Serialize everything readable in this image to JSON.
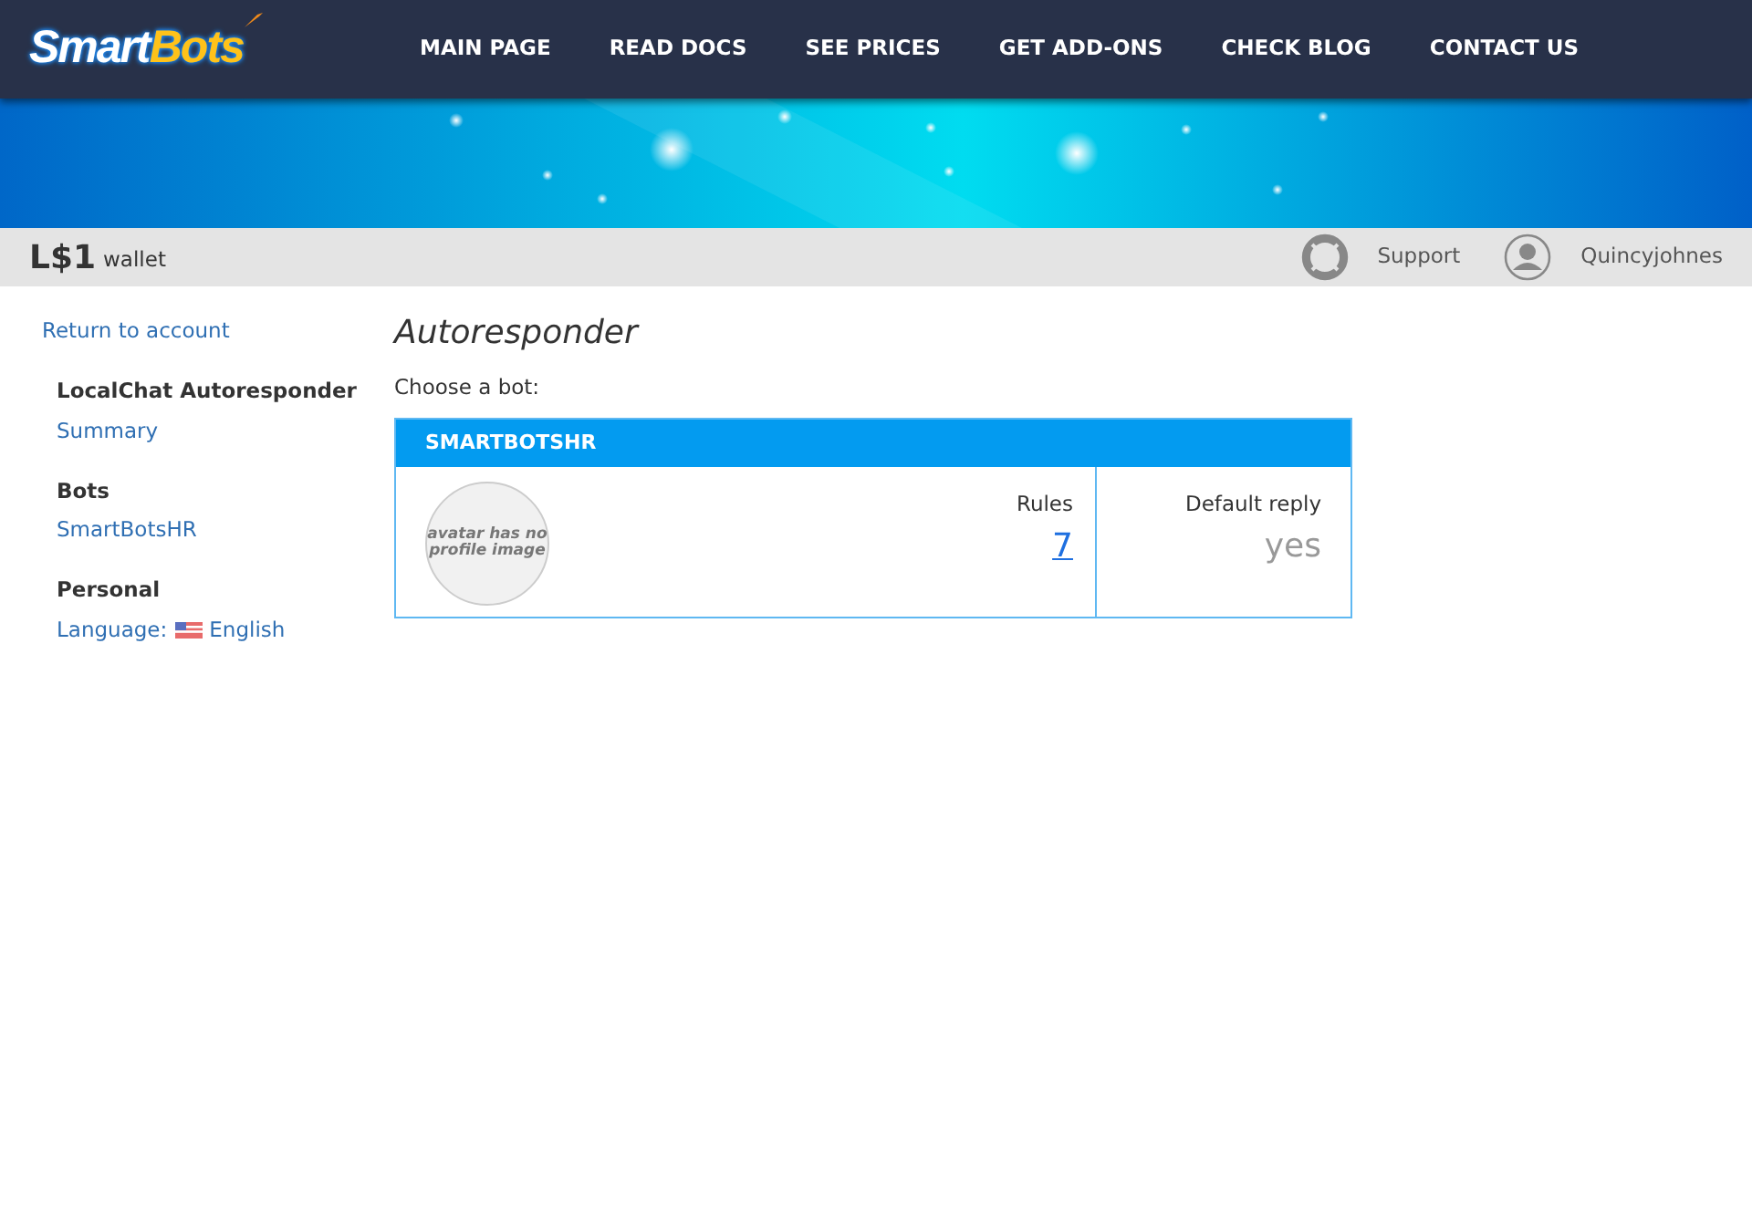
{
  "logo": {
    "part_1": "Smart",
    "part_2": "Bots"
  },
  "nav": [
    "MAIN PAGE",
    "READ DOCS",
    "SEE PRICES",
    "GET ADD-ONS",
    "CHECK BLOG",
    "CONTACT US"
  ],
  "wallet": {
    "amount": "L$1",
    "label": "wallet"
  },
  "support": "Support",
  "user": "Quincyjohnes",
  "sidebar": {
    "back": "Return to account",
    "sections": [
      {
        "title": "LocalChat Autoresponder",
        "links": [
          {
            "text": "Summary"
          }
        ]
      },
      {
        "title": "Bots",
        "links": [
          {
            "text": "SmartBotsHR"
          }
        ]
      },
      {
        "title": "Personal",
        "links": [
          {
            "label": "Language:",
            "text": "English",
            "flag": true
          }
        ]
      }
    ]
  },
  "page_title": "Autoresponder",
  "prompt": "Choose a bot:",
  "bots": [
    {
      "name": "SMARTBOTSHR",
      "avatar_text": "avatar has no profile image",
      "rules_label": "Rules",
      "rules": "7",
      "reply_label": "Default reply",
      "reply": "yes"
    }
  ]
}
